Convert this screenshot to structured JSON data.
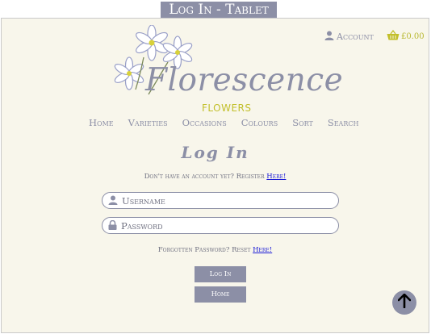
{
  "caption": "Log In - Tablet",
  "header": {
    "account_label": "Account",
    "basket_total": "£0.00"
  },
  "logo": {
    "name": "Florescence",
    "sub": "FLOWERS"
  },
  "nav": {
    "items": [
      "Home",
      "Varieties",
      "Occasions",
      "Colours",
      "Sort",
      "Search"
    ]
  },
  "login": {
    "title": "Log In",
    "register_prompt": "Don't have an account yet? Register",
    "register_link": "Here!",
    "username_placeholder": "Username",
    "password_placeholder": "Password",
    "forgot_prompt": "Forgotten Password? Reset",
    "forgot_link": "Here!",
    "login_button": "Log In",
    "home_button": "Home"
  },
  "colors": {
    "brand": "#8c8fa6",
    "accent": "#c2bf2a",
    "background": "#f8f6eb",
    "link": "#1a1ad6"
  },
  "icons": [
    "user-icon",
    "basket-icon",
    "lock-icon",
    "arrow-up-icon"
  ]
}
